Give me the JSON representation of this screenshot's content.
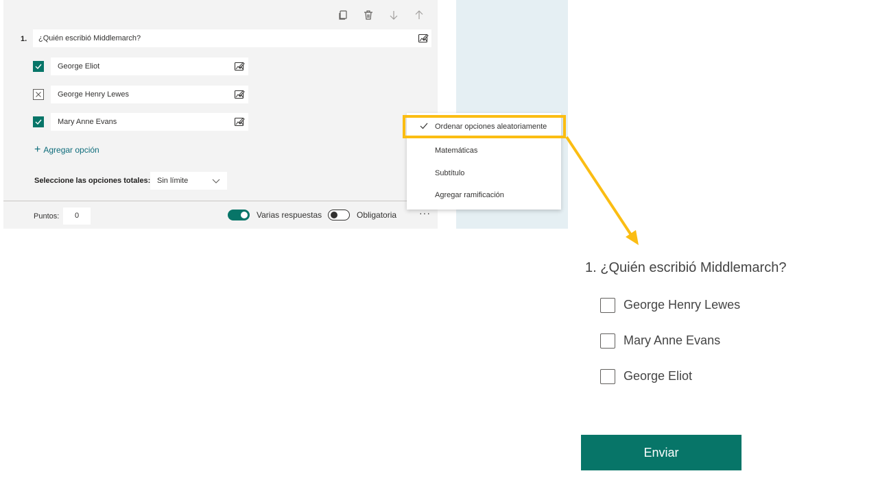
{
  "editor": {
    "toolbar": {
      "icons": [
        "copy-icon",
        "delete-icon",
        "move-down-icon",
        "move-up-icon"
      ]
    },
    "question": {
      "number": "1.",
      "title": "¿Quién escribió Middlemarch?"
    },
    "options": [
      {
        "label": "George Eliot",
        "state": "correct"
      },
      {
        "label": "George Henry Lewes",
        "state": "incorrect"
      },
      {
        "label": "Mary Anne Evans",
        "state": "correct"
      }
    ],
    "add_option_label": "Agregar opción",
    "limit": {
      "label": "Seleccione las opciones totales:",
      "value": "Sin límite"
    },
    "footer": {
      "points_label": "Puntos:",
      "points_value": "0",
      "multiple_answers_label": "Varias respuestas",
      "multiple_answers_on": true,
      "required_label": "Obligatoria",
      "required_on": false,
      "more_label": "···"
    }
  },
  "context_menu": {
    "items": [
      {
        "label": "Ordenar opciones aleatoriamente",
        "checked": true
      },
      {
        "label": "Matemáticas",
        "checked": false
      },
      {
        "label": "Subtítulo",
        "checked": false
      },
      {
        "label": "Agregar ramificación",
        "checked": false
      }
    ]
  },
  "preview": {
    "title": "1. ¿Quién escribió Middlemarch?",
    "options": [
      "George Henry Lewes",
      "Mary Anne Evans",
      "George Eliot"
    ],
    "submit_label": "Enviar"
  },
  "colors": {
    "accent": "#077568",
    "highlight": "#fbbd13",
    "link": "#0c6b7a"
  }
}
